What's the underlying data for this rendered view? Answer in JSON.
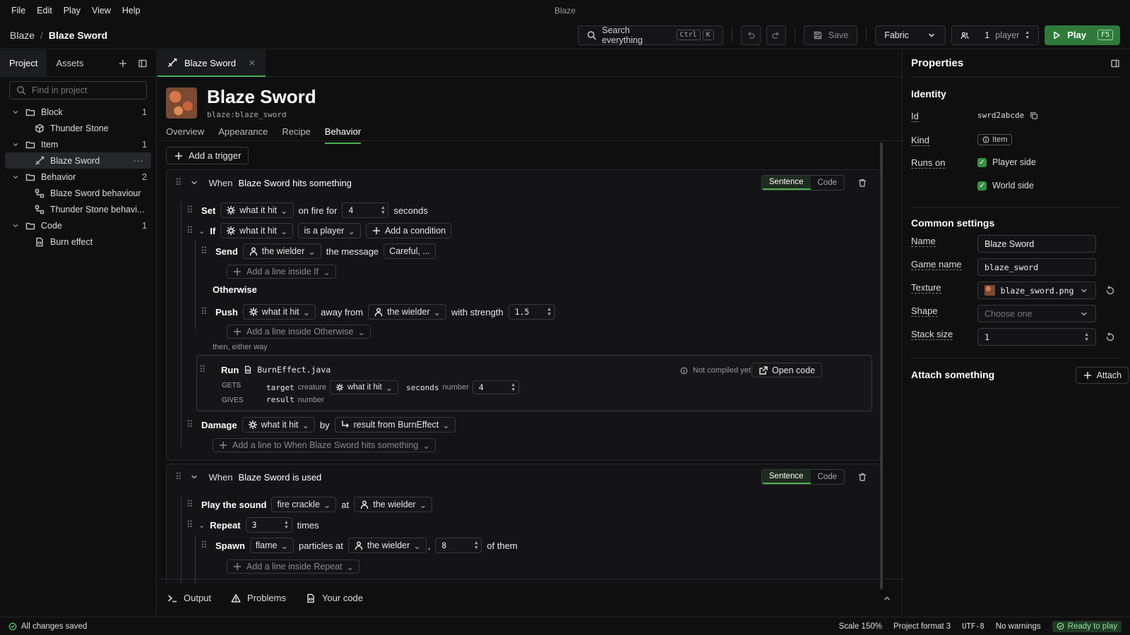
{
  "app": {
    "window_title": "Blaze"
  },
  "menu": [
    "File",
    "Edit",
    "Play",
    "View",
    "Help"
  ],
  "toolbar": {
    "crumb_project": "Blaze",
    "crumb_sep": "/",
    "crumb_item": "Blaze Sword",
    "search_label": "Search everything",
    "search_kbd1": "Ctrl",
    "search_kbd2": "K",
    "save_label": "Save",
    "loader_value": "Fabric",
    "players_count": "1",
    "players_unit": "player",
    "play_label": "Play",
    "play_kbd": "F5"
  },
  "left": {
    "tab_project": "Project",
    "tab_assets": "Assets",
    "search_placeholder": "Find in project",
    "tree": {
      "block": {
        "label": "Block",
        "count": "1"
      },
      "thunder_stone": "Thunder Stone",
      "item": {
        "label": "Item",
        "count": "1"
      },
      "blaze_sword": "Blaze Sword",
      "more": "···",
      "behavior": {
        "label": "Behavior",
        "count": "2"
      },
      "blaze_behaviour": "Blaze Sword behaviour",
      "thunder_behaviour": "Thunder Stone behavi...",
      "code": {
        "label": "Code",
        "count": "1"
      },
      "burn_effect": "Burn effect"
    }
  },
  "editor": {
    "tab_label": "Blaze Sword",
    "title": "Blaze Sword",
    "game_id": "blaze:blaze_sword",
    "subtabs": [
      "Overview",
      "Appearance",
      "Recipe",
      "Behavior"
    ],
    "add_trigger": "Add a trigger",
    "seg_sentence": "Sentence",
    "seg_code": "Code",
    "block1": {
      "when": "When",
      "what": "Blaze Sword hits something",
      "set": {
        "kw": "Set",
        "target": "what it hit",
        "text": "on fire for",
        "value": "4",
        "unit": "seconds"
      },
      "if": {
        "kw": "If",
        "target": "what it hit",
        "cond": "is a player",
        "add_cond": "Add a condition"
      },
      "send": {
        "kw": "Send",
        "target": "the wielder",
        "text": "the message",
        "msg": "Careful, ..."
      },
      "add_if": "Add a line inside If",
      "otherwise": "Otherwise",
      "push": {
        "kw": "Push",
        "target": "what it hit",
        "text1": "away from",
        "from": "the wielder",
        "text2": "with strength",
        "value": "1.5"
      },
      "add_otherwise": "Add a line inside Otherwise",
      "then": "then, either way",
      "run": {
        "kw": "Run",
        "file": "BurnEffect.java",
        "status": "Not compiled yet",
        "open": "Open code",
        "gets": "GETS",
        "gives": "GIVES",
        "p1_name": "target",
        "p1_type": "creature",
        "p1_val": "what it hit",
        "p2_name": "seconds",
        "p2_type": "number",
        "p2_val": "4",
        "r_name": "result",
        "r_type": "number"
      },
      "damage": {
        "kw": "Damage",
        "target": "what it hit",
        "text": "by",
        "val": "result from BurnEffect"
      },
      "add_line": "Add a line to When Blaze Sword hits something"
    },
    "block2": {
      "when": "When",
      "what": "Blaze Sword is used",
      "sound": {
        "kw": "Play the sound",
        "sound": "fire crackle",
        "text": "at",
        "at": "the wielder"
      },
      "repeat": {
        "kw": "Repeat",
        "value": "3",
        "text": "times"
      },
      "spawn": {
        "kw": "Spawn",
        "type": "flame",
        "text": "particles at",
        "at": "the wielder",
        "comma": ",",
        "count": "8",
        "tail": "of them"
      },
      "add_repeat": "Add a line inside Repeat"
    }
  },
  "bottom": {
    "output": "Output",
    "problems": "Problems",
    "your_code": "Your code"
  },
  "props": {
    "title": "Properties",
    "identity": "Identity",
    "id_label": "Id",
    "id_value": "swrd2abcde",
    "kind_label": "Kind",
    "kind_value": "Item",
    "runs_label": "Runs on",
    "runs_player": "Player side",
    "runs_world": "World side",
    "common": "Common settings",
    "name_label": "Name",
    "name_value": "Blaze Sword",
    "gamename_label": "Game name",
    "gamename_value": "blaze_sword",
    "texture_label": "Texture",
    "texture_value": "blaze_sword.png",
    "shape_label": "Shape",
    "shape_placeholder": "Choose one",
    "stack_label": "Stack size",
    "stack_value": "1",
    "attach_title": "Attach something",
    "attach_button": "Attach"
  },
  "status": {
    "saved": "All changes saved",
    "scale": "Scale 150%",
    "format": "Project format 3",
    "encoding": "UTF-8",
    "warnings": "No warnings",
    "ready": "Ready to play"
  }
}
